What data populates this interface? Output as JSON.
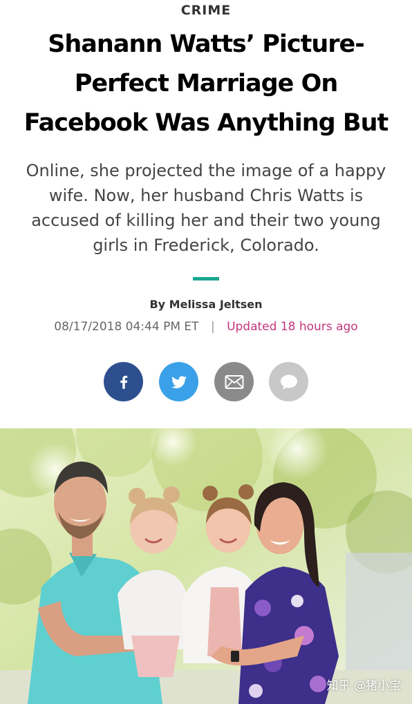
{
  "article": {
    "section": "CRIME",
    "headline": "Shanann Watts’ Picture-Perfect Marriage On Facebook Was Anything But",
    "dek": "Online, she projected the image of a happy wife. Now, her husband Chris Watts is accused of killing her and their two young girls in Frederick, Colorado.",
    "byline": "By Melissa Jeltsen",
    "date": "08/17/2018 04:44 PM ET",
    "separator": "|",
    "updated": "Updated 18 hours ago"
  },
  "share": [
    {
      "icon": "facebook-icon",
      "color": "#2d4f8e"
    },
    {
      "icon": "twitter-icon",
      "color": "#3aa1e8"
    },
    {
      "icon": "email-icon",
      "color": "#8a8a8a"
    },
    {
      "icon": "comment-icon",
      "color": "#c8c8c8"
    }
  ],
  "photo": {
    "watermark": "知乎 @猪小宝"
  },
  "colors": {
    "accent_rule": "#17a891",
    "updated_text": "#c4347c"
  }
}
